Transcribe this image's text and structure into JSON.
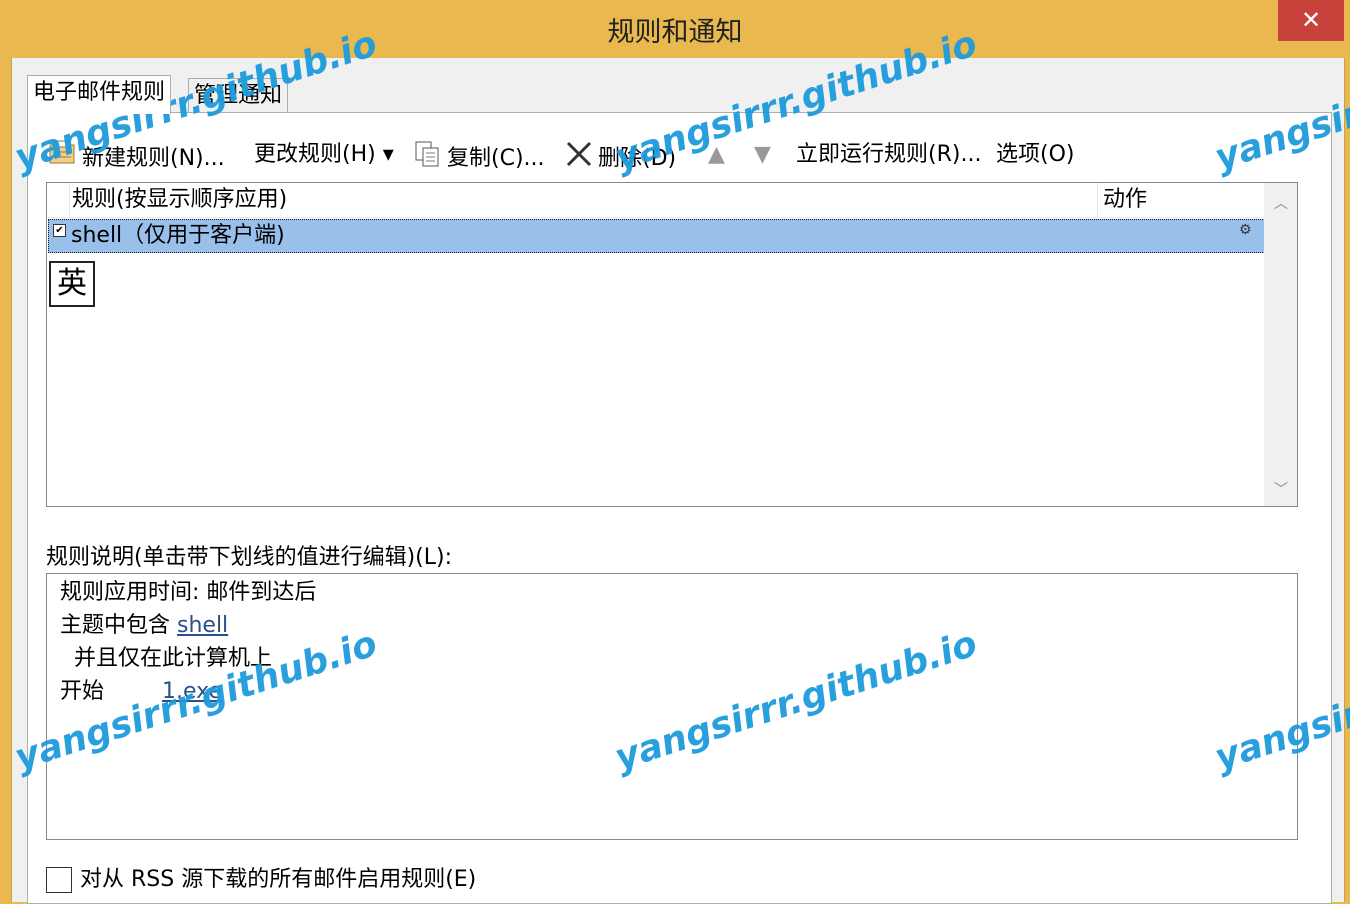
{
  "window": {
    "title": "规则和通知",
    "close_label": "✕"
  },
  "tabs": [
    {
      "label": "电子邮件规则"
    },
    {
      "label": "管理通知"
    }
  ],
  "toolbar": {
    "new_rule": "新建规则(N)...",
    "change_rule": "更改规则(H)",
    "copy": "复制(C)...",
    "delete": "删除(D)",
    "run_rules": "立即运行规则(R)...",
    "options": "选项(O)"
  },
  "rules_list": {
    "col_rule": "规则(按显示顺序应用)",
    "col_action": "动作",
    "rows": [
      {
        "name": "shell（仅用于客户端)",
        "checked": true
      }
    ],
    "ime_indicator": "英"
  },
  "description": {
    "label": "规则说明(单击带下划线的值进行编辑)(L):",
    "line1": "规则应用时间: 邮件到达后",
    "line2_prefix": "主题中包含 ",
    "line2_link": "shell",
    "line3": "  并且仅在此计算机上",
    "line4_prefix": "开始",
    "line4_link": "1.exe"
  },
  "rss_checkbox": {
    "label": "对从 RSS 源下载的所有邮件启用规则(E)",
    "checked": false
  },
  "watermarks": [
    "yangsirrr.github.io",
    "yangsirrr.github.io",
    "yangsirr",
    "yangsirrr.github.io",
    "yangsirrr.github.io",
    "yangsirr"
  ]
}
